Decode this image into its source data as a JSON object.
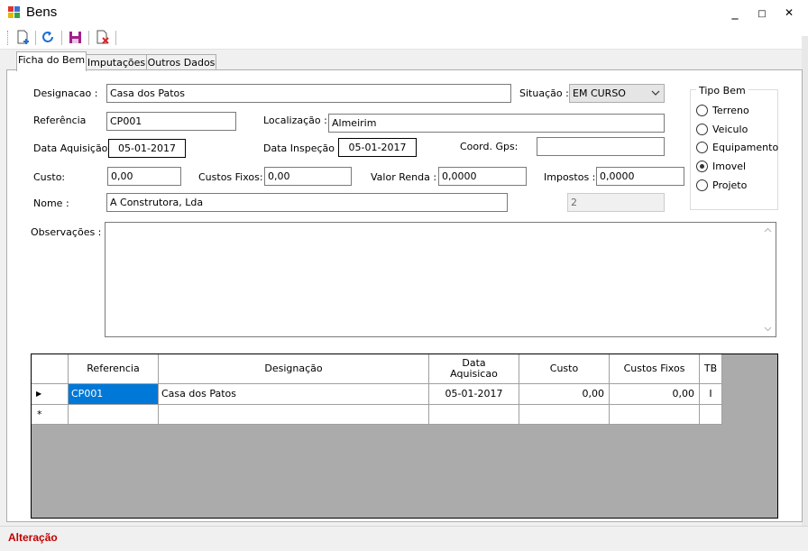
{
  "window": {
    "title": "Bens",
    "minimize": "_",
    "maximize": "□",
    "close": "✕"
  },
  "toolbar": {
    "buttons": [
      {
        "icon": "new-document-icon"
      },
      {
        "icon": "refresh-icon"
      },
      {
        "icon": "save-icon"
      },
      {
        "icon": "delete-document-icon"
      }
    ]
  },
  "tabs": [
    {
      "label": "Ficha do Bem"
    },
    {
      "label": "Imputações"
    },
    {
      "label": "Outros Dados"
    }
  ],
  "form": {
    "designacao_label": "Designacao :",
    "designacao_value": "Casa dos Patos",
    "situacao_label": "Situação :",
    "situacao_value": "EM CURSO",
    "referencia_label": "Referência",
    "referencia_value": "CP001",
    "localizacao_label": "Localização :",
    "localizacao_value": "Almeirim",
    "data_aquisicao_label": "Data Aquisição :",
    "data_aquisicao_value": "05-01-2017",
    "data_inspecao_label": "Data Inspeção :",
    "data_inspecao_value": "05-01-2017",
    "coord_label": "Coord. Gps:",
    "coord_value": "",
    "custo_label": "Custo:",
    "custo_value": "0,00",
    "custos_fixos_label": "Custos Fixos:",
    "custos_fixos_value": "0,00",
    "valor_renda_label": "Valor Renda :",
    "valor_renda_value": "0,0000",
    "impostos_label": "Impostos :",
    "impostos_value": "0,0000",
    "nome_label": "Nome :",
    "nome_value": "A Construtora, Lda",
    "id_value": "2",
    "observacoes_label": "Observações :",
    "observacoes_value": ""
  },
  "tipo_bem": {
    "title": "Tipo Bem",
    "options": [
      {
        "label": "Terreno",
        "selected": false
      },
      {
        "label": "Veiculo",
        "selected": false
      },
      {
        "label": "Equipamento",
        "selected": false
      },
      {
        "label": "Imovel",
        "selected": true
      },
      {
        "label": "Projeto",
        "selected": false
      }
    ]
  },
  "grid": {
    "headers": {
      "referencia": "Referencia",
      "designacao": "Designação",
      "data_aquisicao_1": "Data",
      "data_aquisicao_2": "Aquisicao",
      "custo": "Custo",
      "custos_fixos": "Custos Fixos",
      "tb": "TB"
    },
    "rows": [
      {
        "indicator": "▶",
        "referencia": "CP001",
        "designacao": "Casa dos Patos",
        "data_aquisicao": "05-01-2017",
        "custo": "0,00",
        "custos_fixos": "0,00",
        "tb": "I"
      }
    ],
    "new_row_indicator": "*"
  },
  "status": {
    "text": "Alteração"
  }
}
